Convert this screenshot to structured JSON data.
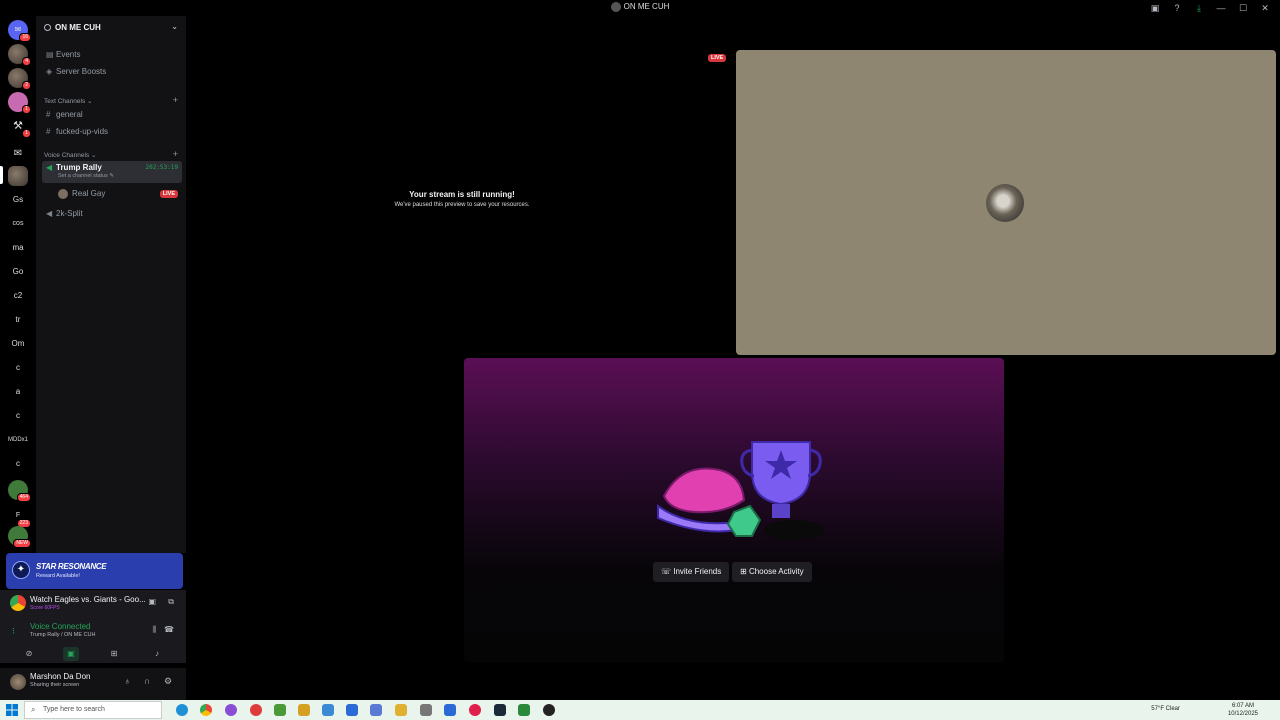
{
  "window": {
    "title": "ON ME CUH"
  },
  "rail": {
    "text_servers": [
      "Gs",
      "cos",
      "ma",
      "Go",
      "c2",
      "tr",
      "Om",
      "c",
      "a",
      "c",
      "MDDx1",
      "c"
    ],
    "badges": [
      "16",
      "4",
      "2",
      "1",
      "1",
      "464",
      "223",
      "NEW"
    ]
  },
  "sidebar": {
    "server_name": "ON ME CUH",
    "events": "Events",
    "boosts": "Server Boosts",
    "text_category": "Text Channels",
    "text_channels": [
      "general",
      "fucked-up-vids"
    ],
    "voice_category": "Voice Channels",
    "active_voice": {
      "name": "Trump Rally",
      "status": "Set a channel status",
      "timer": "202:53:19"
    },
    "voice_user": {
      "name": "Real Gay",
      "badge": "LIVE"
    },
    "other_voice": "2k-Split"
  },
  "promo": {
    "title": "STAR RESONANCE",
    "subtitle": "Reward Available!"
  },
  "activity": {
    "title": "Watch Eagles vs. Giants - Goo...",
    "subtitle": "Score 60FPS"
  },
  "voice": {
    "status": "Voice Connected",
    "location": "Trump Rally / ON ME CUH"
  },
  "user": {
    "name": "Marshon Da Don",
    "status": "Sharing their screen"
  },
  "stage": {
    "paused_title": "Your stream is still running!",
    "paused_sub": "We've paused this preview to save your resources.",
    "live_badge": "LIVE",
    "invite_label": "Invite Friends",
    "choose_label": "Choose Activity"
  },
  "taskbar": {
    "search_placeholder": "Type here to search",
    "weather": "57°F  Clear",
    "time": "6:07 AM",
    "date": "10/12/2025"
  },
  "colors": {
    "accent_green": "#23a55a",
    "live_red": "#da373c",
    "promo_blue": "#2a3fad"
  }
}
